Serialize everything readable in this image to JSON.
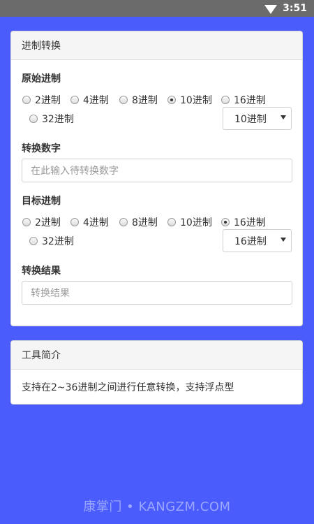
{
  "status": {
    "time": "3:51"
  },
  "converter": {
    "title": "进制转换",
    "source_label": "原始进制",
    "source_options": [
      "2进制",
      "4进制",
      "8进制",
      "10进制",
      "16进制",
      "32进制"
    ],
    "source_selected": "10进制",
    "source_select_value": "10进制",
    "number_label": "转换数字",
    "number_placeholder": "在此输入待转换数字",
    "target_label": "目标进制",
    "target_options": [
      "2进制",
      "4进制",
      "8进制",
      "10进制",
      "16进制",
      "32进制"
    ],
    "target_selected": "16进制",
    "target_select_value": "16进制",
    "result_label": "转换结果",
    "result_placeholder": "转换结果"
  },
  "intro": {
    "title": "工具简介",
    "text": "支持在2~36进制之间进行任意转换，支持浮点型"
  },
  "watermark": "康掌门 • KANGZM.COM"
}
